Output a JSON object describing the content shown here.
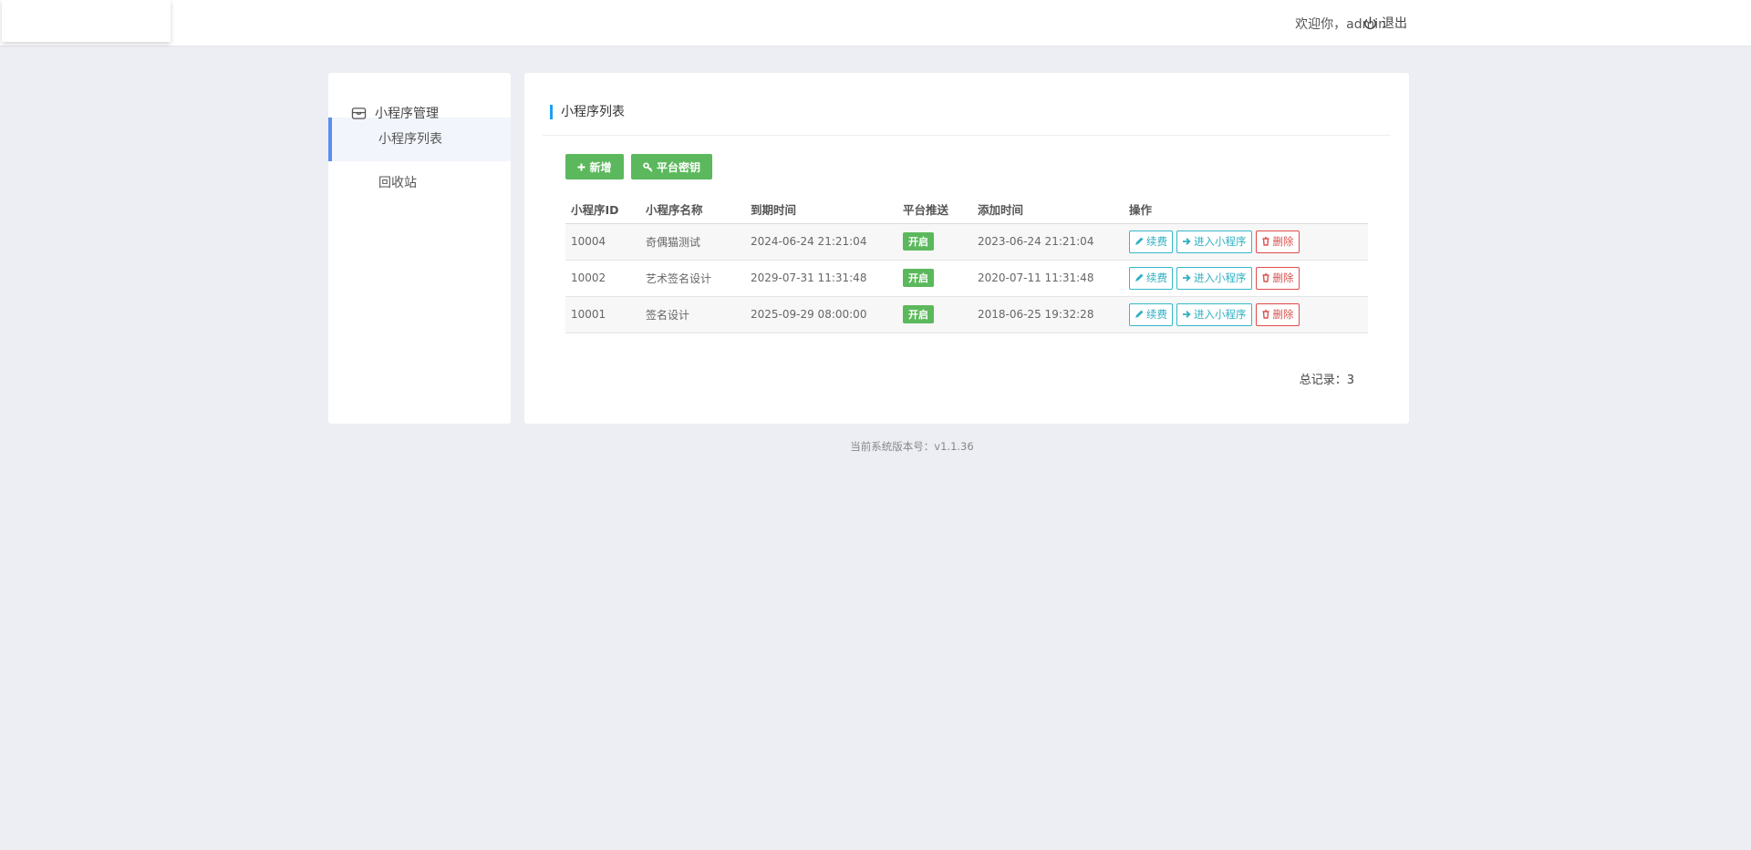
{
  "header": {
    "welcome": "欢迎你，admin",
    "logout_label": "退出"
  },
  "sidebar": {
    "group_label": "小程序管理",
    "items": [
      {
        "label": "小程序列表",
        "active": true
      },
      {
        "label": "回收站",
        "active": false
      }
    ]
  },
  "main": {
    "title": "小程序列表",
    "add_label": "新增",
    "key_label": "平台密钥",
    "columns": [
      "小程序ID",
      "小程序名称",
      "到期时间",
      "平台推送",
      "添加时间",
      "操作"
    ],
    "rows": [
      {
        "id": "10004",
        "name": "奇偶猫测试",
        "expire": "2024-06-24 21:21:04",
        "push": "开启",
        "added": "2023-06-24 21:21:04"
      },
      {
        "id": "10002",
        "name": "艺术签名设计",
        "expire": "2029-07-31 11:31:48",
        "push": "开启",
        "added": "2020-07-11 11:31:48"
      },
      {
        "id": "10001",
        "name": "签名设计",
        "expire": "2025-09-29 08:00:00",
        "push": "开启",
        "added": "2018-06-25 19:32:28"
      }
    ],
    "actions": {
      "renew": "续费",
      "enter": "进入小程序",
      "delete": "删除"
    },
    "total": "总记录：3"
  },
  "footer": {
    "version": "当前系统版本号：v1.1.36"
  },
  "colors": {
    "accent_green": "#5cb85c",
    "info": "#2fb0c2",
    "danger": "#d9534f",
    "title_bar": "#1e9ff2"
  }
}
